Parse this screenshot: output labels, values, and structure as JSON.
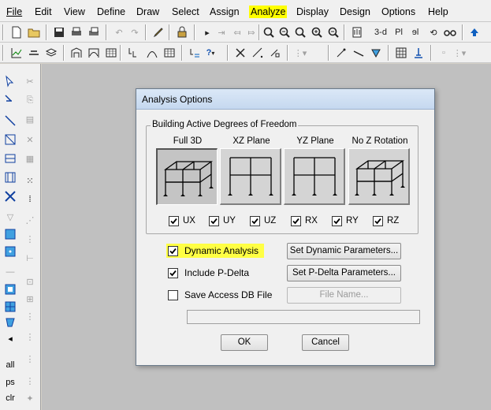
{
  "menubar": {
    "items": [
      {
        "label": "File",
        "hotkey_index": 0
      },
      {
        "label": "Edit",
        "hotkey_index": 0
      },
      {
        "label": "View",
        "hotkey_index": 0
      },
      {
        "label": "Define",
        "hotkey_index": 0
      },
      {
        "label": "Draw",
        "hotkey_index": 0
      },
      {
        "label": "Select",
        "hotkey_index": 0
      },
      {
        "label": "Assign",
        "hotkey_index": 0
      },
      {
        "label": "Analyze",
        "hotkey_index": 0,
        "highlighted": true
      },
      {
        "label": "Display",
        "hotkey_index": 0
      },
      {
        "label": "Design",
        "hotkey_index": 0
      },
      {
        "label": "Options",
        "hotkey_index": 0
      },
      {
        "label": "Help",
        "hotkey_index": 0
      }
    ]
  },
  "toolbar": {
    "three_d_label": "3-d",
    "plan_label": "Pl",
    "elev_label": "ɘl"
  },
  "lefttoolbar": {
    "all_label": "all",
    "ps_label": "ps",
    "clr_label": "clr"
  },
  "dialog": {
    "title": "Analysis Options",
    "dof_group": {
      "legend": "Building Active Degrees of Freedom",
      "planes": [
        {
          "label": "Full 3D",
          "selected": true,
          "icon": "full-3d-frame-icon"
        },
        {
          "label": "XZ Plane",
          "selected": false,
          "icon": "xz-plane-frame-icon"
        },
        {
          "label": "YZ Plane",
          "selected": false,
          "icon": "yz-plane-frame-icon"
        },
        {
          "label": "No Z Rotation",
          "selected": false,
          "icon": "no-z-rotation-frame-icon"
        }
      ],
      "dofs": [
        {
          "label": "UX",
          "checked": true
        },
        {
          "label": "UY",
          "checked": true
        },
        {
          "label": "UZ",
          "checked": true
        },
        {
          "label": "RX",
          "checked": true
        },
        {
          "label": "RY",
          "checked": true
        },
        {
          "label": "RZ",
          "checked": true
        }
      ]
    },
    "options": {
      "dynamic_analysis": {
        "label": "Dynamic Analysis",
        "checked": true,
        "highlighted": true
      },
      "include_pdelta": {
        "label": "Include P-Delta",
        "checked": true
      },
      "save_access_db": {
        "label": "Save Access DB File",
        "checked": false
      }
    },
    "buttons": {
      "set_dynamic": "Set Dynamic Parameters...",
      "set_pdelta": "Set P-Delta Parameters...",
      "file_name": "File Name...",
      "ok": "OK",
      "cancel": "Cancel"
    },
    "file_path_value": ""
  },
  "colors": {
    "menu_highlight": "#ffff00",
    "option_highlight": "#ffff44",
    "workspace": "#c0c0c0",
    "dialog_bg": "#f0f0f0"
  }
}
